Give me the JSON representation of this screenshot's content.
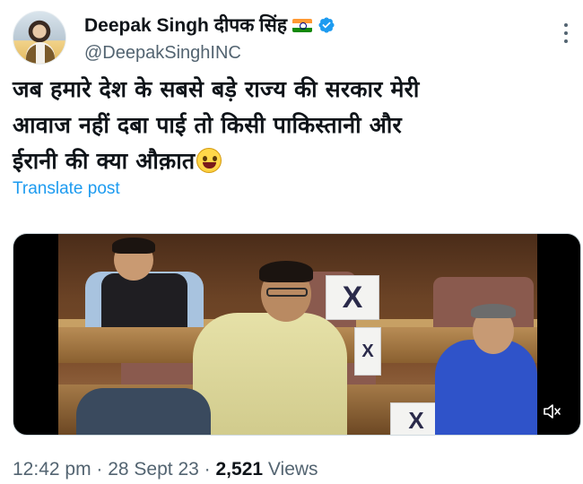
{
  "author": {
    "display_name": "Deepak Singh दीपक सिंह",
    "flag_icon": "india-flag-icon",
    "verified_icon": "verified-badge-icon",
    "handle": "@DeepakSinghINC"
  },
  "tweet": {
    "lines": [
      "जब हमारे देश के सबसे बड़े राज्य की सरकार मेरी",
      "आवाज नहीं दबा पाई तो किसी पाकिस्तानी और",
      "ईरानी की क्या औक़ात"
    ],
    "emoji": "grinning-face-emoji",
    "translate_label": "Translate post"
  },
  "media": {
    "type": "video",
    "card_letter": "X",
    "mute_icon": "speaker-muted-icon"
  },
  "meta": {
    "time": "12:42 pm",
    "sep1": " · ",
    "date": "28 Sept 23",
    "sep2": " · ",
    "views_count": "2,521",
    "views_label": " Views"
  },
  "colors": {
    "accent": "#1d9bf0",
    "secondary_text": "#536471",
    "primary_text": "#0f1419"
  }
}
